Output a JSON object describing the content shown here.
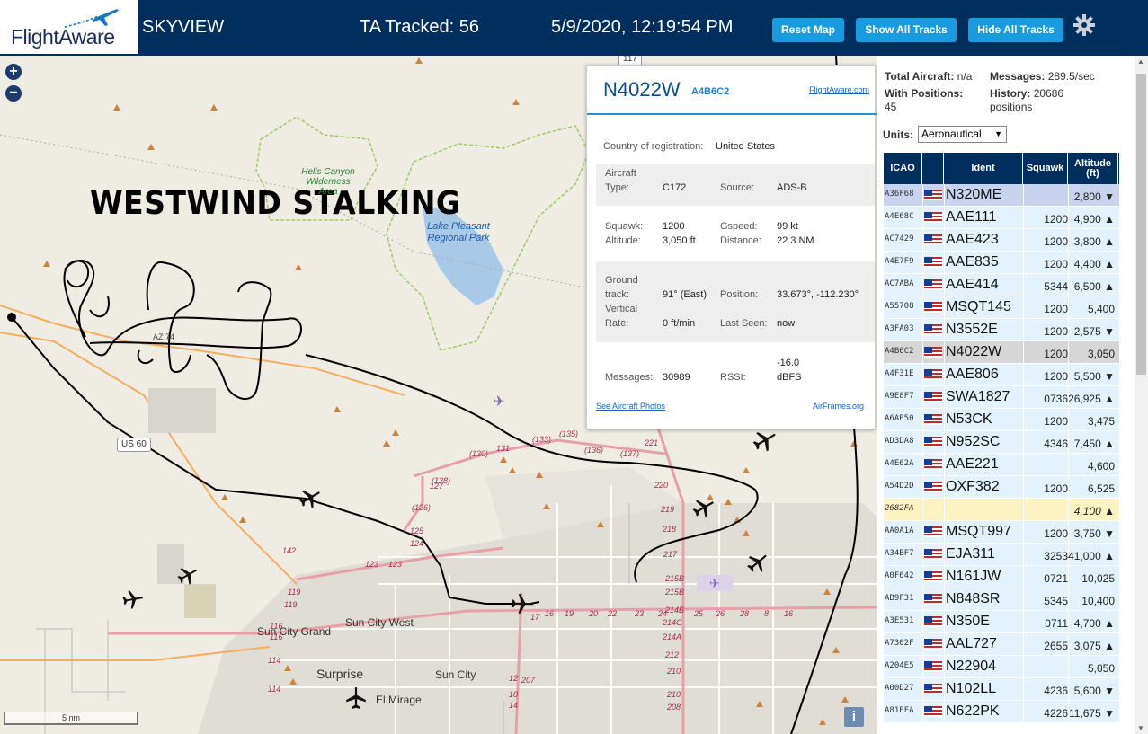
{
  "header": {
    "logo_text": "FlightAware",
    "app_title": "SKYVIEW",
    "tracked": "TA Tracked: 56",
    "datetime": "5/9/2020, 12:19:54 PM",
    "buttons": {
      "reset": "Reset Map",
      "show": "Show All Tracks",
      "hide": "Hide All Tracks"
    },
    "settings_icon": "gear-icon"
  },
  "map": {
    "zoom_in": "+",
    "zoom_out": "−",
    "overlay_text": "WESTWIND STALKING",
    "scale_label": "5 nm",
    "info_button": "i",
    "places": {
      "surprise": "Surprise",
      "sun_city_west": "Sun City West",
      "sun_city_grand": "Sun City Grand",
      "sun_city": "Sun City",
      "el_mirage": "El Mirage",
      "hells_canyon": "Hells Canyon Wilderness Area",
      "lake_pleasant": "Lake Pleasant Regional Park",
      "us60": "US 60",
      "az74": "AZ 74",
      "r117": "117"
    },
    "exits": [
      "(135)",
      "(133)",
      "131",
      "(130)",
      "(136)",
      "(137)",
      "221",
      "(128)",
      "127",
      "(126)",
      "125",
      "124",
      "123",
      "123",
      "142",
      "119",
      "119",
      "116",
      "116",
      "114",
      "114",
      "220",
      "219",
      "218",
      "217",
      "215B",
      "215B",
      "214C",
      "214B",
      "214A",
      "212",
      "210",
      "210",
      "208",
      "207",
      "17",
      "16",
      "19",
      "20",
      "22",
      "23",
      "24",
      "25",
      "26",
      "28",
      "8",
      "16",
      "14",
      "12",
      "10"
    ]
  },
  "popup": {
    "callsign": "N4022W",
    "hex": "A4B6C2",
    "fa_link": "FlightAware.com",
    "country_label": "Country of registration:",
    "country_value": "United States",
    "aircraft_type_label": "Aircraft Type:",
    "aircraft_type_value": "C172",
    "source_label": "Source:",
    "source_value": "ADS-B",
    "squawk_label": "Squawk:",
    "squawk_value": "1200",
    "gspeed_label": "Gspeed:",
    "gspeed_value": "99 kt",
    "altitude_label": "Altitude:",
    "altitude_value": "3,050 ft",
    "distance_label": "Distance:",
    "distance_value": "22.3 NM",
    "track_label": "Ground track:",
    "track_value": "91° (East)",
    "position_label": "Position:",
    "position_value": "33.673°, -112.230°",
    "vrate_label": "Vertical Rate:",
    "vrate_value": "0 ft/min",
    "lastseen_label": "Last Seen:",
    "lastseen_value": "now",
    "messages_label": "Messages:",
    "messages_value": "30989",
    "rssi_label": "RSSI:",
    "rssi_value": "-16.0 dBFS",
    "photos_link": "See Aircraft Photos",
    "airframes_link": "AirFrames.org"
  },
  "sidebar": {
    "total_label": "Total Aircraft:",
    "total_value": "n/a",
    "messages_label": "Messages:",
    "messages_value": "289.5/sec",
    "withpos_label": "With Positions:",
    "withpos_value": "45",
    "history_label": "History:",
    "history_value": "20686 positions",
    "units_label": "Units:",
    "units_value": "Aeronautical",
    "columns": [
      "ICAO",
      "Ident",
      "Squawk",
      "Altitude (ft)",
      "Sp"
    ],
    "rows": [
      {
        "icao": "A36F68",
        "ident": "N320ME",
        "squawk": "",
        "alt": "2,800 ▼",
        "style": "top"
      },
      {
        "icao": "A4E68C",
        "ident": "AAE111",
        "squawk": "1200",
        "alt": "4,900 ▲",
        "style": ""
      },
      {
        "icao": "AC7429",
        "ident": "AAE423",
        "squawk": "1200",
        "alt": "3,800 ▲",
        "style": ""
      },
      {
        "icao": "A4E7F9",
        "ident": "AAE835",
        "squawk": "1200",
        "alt": "4,400 ▲",
        "style": ""
      },
      {
        "icao": "AC7ABA",
        "ident": "AAE414",
        "squawk": "5344",
        "alt": "6,500 ▲",
        "style": ""
      },
      {
        "icao": "A55708",
        "ident": "MSQT145",
        "squawk": "1200",
        "alt": "5,400",
        "style": ""
      },
      {
        "icao": "A3FA03",
        "ident": "N3552E",
        "squawk": "1200",
        "alt": "2,575 ▼",
        "style": ""
      },
      {
        "icao": "A4B6C2",
        "ident": "N4022W",
        "squawk": "1200",
        "alt": "3,050",
        "style": "sel"
      },
      {
        "icao": "A4F31E",
        "ident": "AAE806",
        "squawk": "1200",
        "alt": "5,500 ▼",
        "style": ""
      },
      {
        "icao": "A9E8F7",
        "ident": "SWA1827",
        "squawk": "0736",
        "alt": "26,925 ▲",
        "style": ""
      },
      {
        "icao": "A6AE50",
        "ident": "N53CK",
        "squawk": "1200",
        "alt": "3,475",
        "style": ""
      },
      {
        "icao": "AD3DA8",
        "ident": "N952SC",
        "squawk": "4346",
        "alt": "7,450 ▲",
        "style": ""
      },
      {
        "icao": "A4E62A",
        "ident": "AAE221",
        "squawk": "",
        "alt": "4,600",
        "style": ""
      },
      {
        "icao": "A54D2D",
        "ident": "OXF382",
        "squawk": "1200",
        "alt": "6,525",
        "style": ""
      },
      {
        "icao": "2682FA",
        "ident": "",
        "squawk": "",
        "alt": "4,100 ▲",
        "style": "hl"
      },
      {
        "icao": "AA0A1A",
        "ident": "MSQT997",
        "squawk": "1200",
        "alt": "3,750 ▼",
        "style": ""
      },
      {
        "icao": "A34BF7",
        "ident": "EJA311",
        "squawk": "3253",
        "alt": "41,000 ▲",
        "style": ""
      },
      {
        "icao": "A0F642",
        "ident": "N161JW",
        "squawk": "0721",
        "alt": "10,025",
        "style": ""
      },
      {
        "icao": "AB9F31",
        "ident": "N848SR",
        "squawk": "5345",
        "alt": "10,400",
        "style": ""
      },
      {
        "icao": "A3E531",
        "ident": "N350E",
        "squawk": "0711",
        "alt": "4,700 ▲",
        "style": ""
      },
      {
        "icao": "A7302F",
        "ident": "AAL727",
        "squawk": "2655",
        "alt": "3,075 ▲",
        "style": ""
      },
      {
        "icao": "A204E5",
        "ident": "N22904",
        "squawk": "",
        "alt": "5,050",
        "style": ""
      },
      {
        "icao": "A00D27",
        "ident": "N102LL",
        "squawk": "4236",
        "alt": "5,600 ▼",
        "style": ""
      },
      {
        "icao": "A81EFA",
        "ident": "N622PK",
        "squawk": "4226",
        "alt": "11,675 ▼",
        "style": ""
      }
    ]
  }
}
